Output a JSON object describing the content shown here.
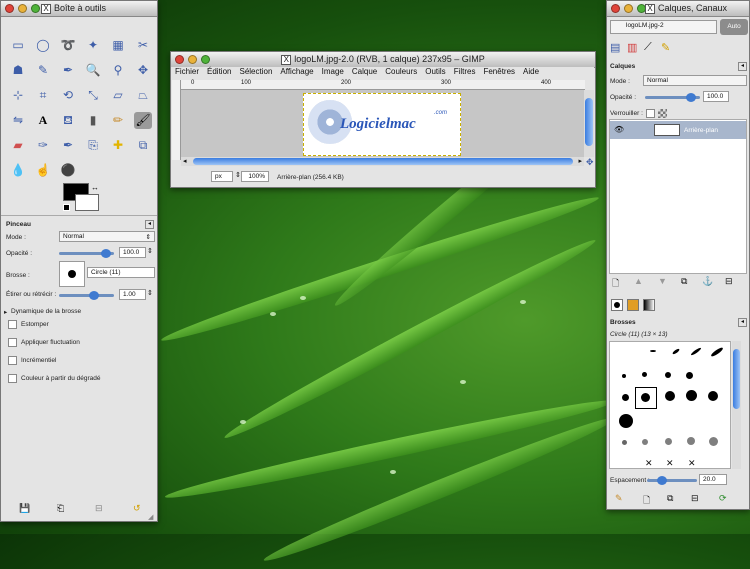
{
  "toolbox": {
    "title": "Boîte à outils",
    "pinceau": {
      "header": "Pinceau",
      "mode_label": "Mode :",
      "mode_value": "Normal",
      "opacity_label": "Opacité :",
      "opacity_value": "100.0",
      "brush_label": "Brosse :",
      "brush_value": "Circle (11)",
      "scale_label": "Étirer ou rétrécir :",
      "scale_value": "1.00",
      "dynamics_label": "Dynamique de la brosse",
      "options": [
        "Estomper",
        "Appliquer fluctuation",
        "Incrémentiel",
        "Couleur à partir du dégradé"
      ]
    }
  },
  "image_window": {
    "title": "logoLM.jpg-2.0 (RVB, 1 calque) 237x95 – GIMP",
    "menu": [
      "Fichier",
      "Édition",
      "Sélection",
      "Affichage",
      "Image",
      "Calque",
      "Couleurs",
      "Outils",
      "Filtres",
      "Fenêtres",
      "Aide"
    ],
    "ruler_ticks": [
      "0",
      "100",
      "200",
      "300",
      "400"
    ],
    "unit": "px",
    "zoom": "100%",
    "status": "Arrière-plan (256.4 KB)",
    "logo_text": "Logicielmac",
    "logo_sup": ".com"
  },
  "layers": {
    "title": "Calques, Canaux",
    "image_select": "logoLM.jpg-2",
    "auto_button": "Auto",
    "header": "Calques",
    "mode_label": "Mode :",
    "mode_value": "Normal",
    "opacity_label": "Opacité :",
    "opacity_value": "100.0",
    "lock_label": "Verrouiller :",
    "layer_name": "Arrière-plan",
    "brushes_header": "Brosses",
    "brush_info": "Circle (11) (13 × 13)",
    "spacing_label": "Espacement :",
    "spacing_value": "20.0"
  },
  "colors": {
    "accent": "#3f7ad0",
    "selected_layer": "#a8b6cc"
  }
}
